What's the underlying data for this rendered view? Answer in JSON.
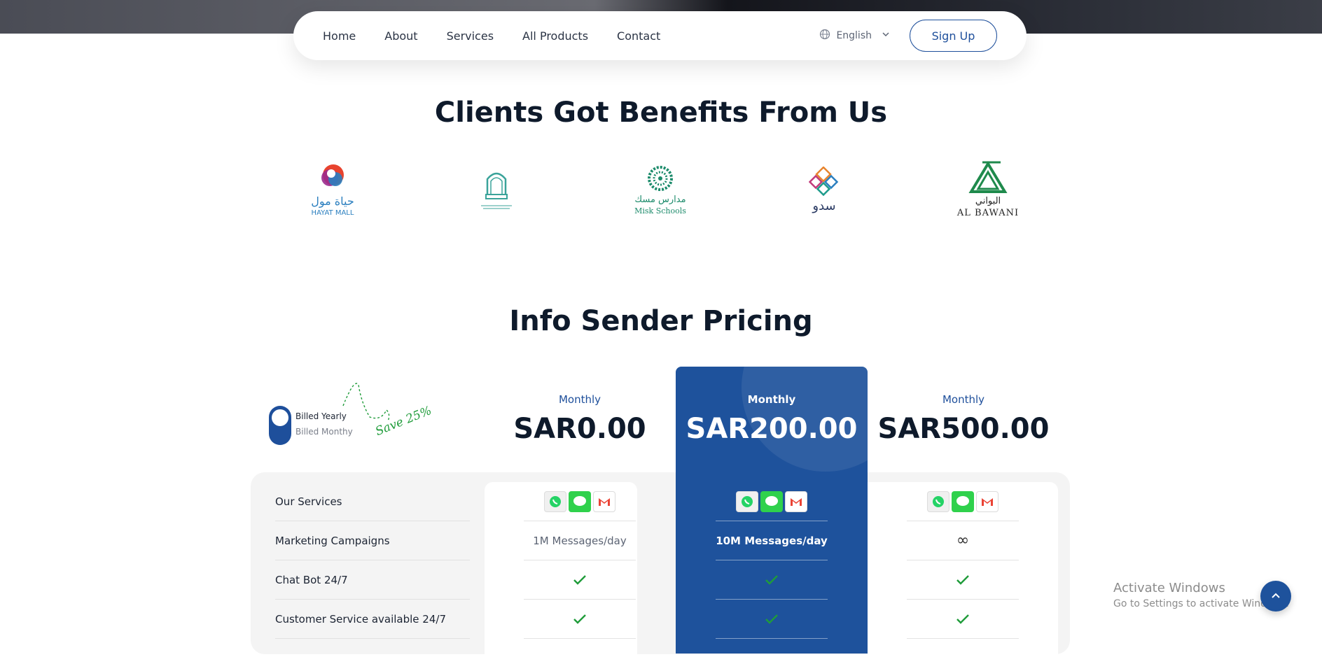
{
  "nav": {
    "links": [
      "Home",
      "About",
      "Services",
      "All Products",
      "Contact"
    ],
    "language": "English",
    "signup": "Sign Up"
  },
  "clients": {
    "title": "Clients Got Benefits From Us",
    "logos": [
      {
        "name": "HAYAT MALL",
        "arabic": "حياة مول",
        "color": "#2b7fbf"
      },
      {
        "name": "",
        "arabic": "",
        "color": "#3aa39a"
      },
      {
        "name": "Misk Schools",
        "arabic": "مدارس مسك",
        "color": "#1c8b6b"
      },
      {
        "name": "",
        "arabic": "سدو",
        "color": "#2a3a63"
      },
      {
        "name": "AL BAWANI",
        "arabic": "البواني",
        "color": "#1f8a4c"
      }
    ]
  },
  "pricing": {
    "title": "Info Sender Pricing",
    "billed_yearly": "Billed Yearly",
    "billed_monthly": "Billed Monthy",
    "save": "Save 25%",
    "plans": [
      {
        "period": "Monthly",
        "price": "SAR0.00",
        "campaigns": "1M Messages/day"
      },
      {
        "period": "Monthly",
        "price": "SAR200.00",
        "campaigns": "10M Messages/day"
      },
      {
        "period": "Monthly",
        "price": "SAR500.00",
        "campaigns": "∞"
      }
    ],
    "rows": [
      "Our Services",
      "Marketing Campaigns",
      "Chat Bot 24/7",
      "Customer Service available 24/7"
    ]
  },
  "windows": {
    "activate_title": "Activate Windows",
    "activate_sub": "Go to Settings to activate Windows."
  },
  "colors": {
    "accent": "#1e529c",
    "check": "#1f9c3a"
  }
}
